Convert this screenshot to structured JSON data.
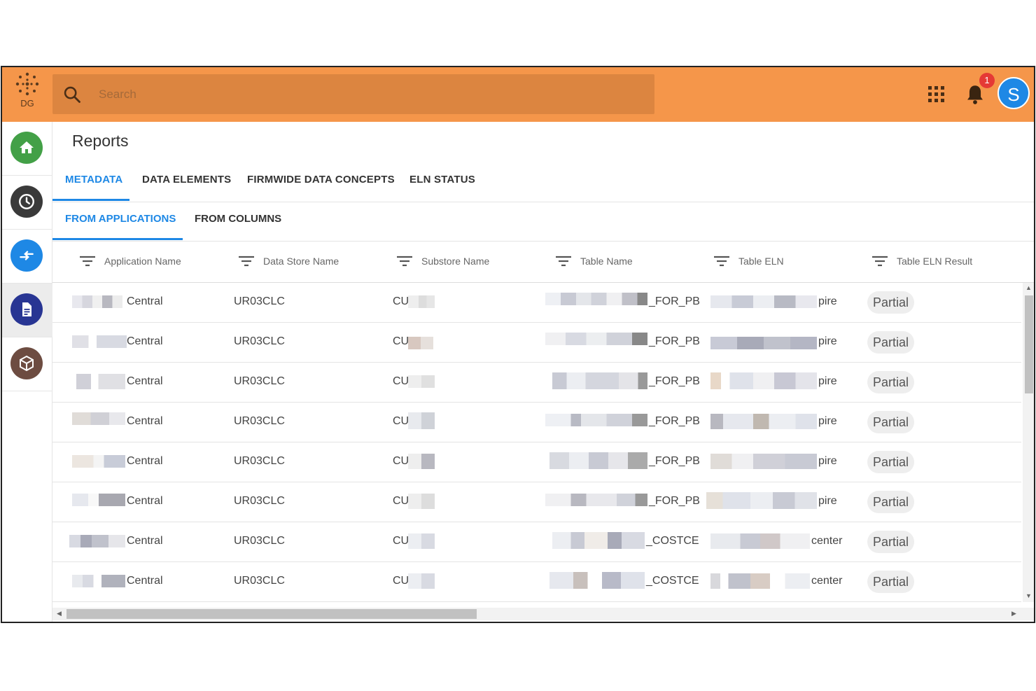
{
  "app": {
    "logo_text": "DG"
  },
  "search": {
    "placeholder": "Search"
  },
  "notifications": {
    "count": "1"
  },
  "user": {
    "initial": "S"
  },
  "page": {
    "title": "Reports"
  },
  "tabs": [
    {
      "label": "METADATA"
    },
    {
      "label": "DATA ELEMENTS"
    },
    {
      "label": "FIRMWIDE DATA CONCEPTS"
    },
    {
      "label": "ELN STATUS"
    }
  ],
  "subtabs": [
    {
      "label": "FROM APPLICATIONS"
    },
    {
      "label": "FROM COLUMNS"
    }
  ],
  "table": {
    "headers": [
      "Application Name",
      "Data Store Name",
      "Substore Name",
      "Table Name",
      "Table ELN",
      "Table ELN Result"
    ],
    "rows": [
      {
        "app": "Central",
        "store": "UR03CLC",
        "substore": "CU",
        "table": "_FOR_PB",
        "eln": "pire",
        "result": "Partial"
      },
      {
        "app": "Central",
        "store": "UR03CLC",
        "substore": "CU",
        "table": "_FOR_PB",
        "eln": "pire",
        "result": "Partial"
      },
      {
        "app": "Central",
        "store": "UR03CLC",
        "substore": "CU",
        "table": "_FOR_PB",
        "eln": "pire",
        "result": "Partial"
      },
      {
        "app": "Central",
        "store": "UR03CLC",
        "substore": "CU",
        "table": "_FOR_PB",
        "eln": "pire",
        "result": "Partial"
      },
      {
        "app": "Central",
        "store": "UR03CLC",
        "substore": "CU",
        "table": "_FOR_PB",
        "eln": "pire",
        "result": "Partial"
      },
      {
        "app": "Central",
        "store": "UR03CLC",
        "substore": "CU",
        "table": "_FOR_PB",
        "eln": "pire",
        "result": "Partial"
      },
      {
        "app": "Central",
        "store": "UR03CLC",
        "substore": "CU",
        "table": "_COSTCE",
        "eln": "center",
        "result": "Partial"
      },
      {
        "app": "Central",
        "store": "UR03CLC",
        "substore": "CU",
        "table": "_COSTCE",
        "eln": "center",
        "result": "Partial"
      }
    ]
  },
  "sidebar": {
    "items": [
      {
        "icon": "home-icon",
        "color": "#43a047"
      },
      {
        "icon": "clock-icon",
        "color": "#3a3a3a"
      },
      {
        "icon": "swap-arrows-icon",
        "color": "#1e88e5"
      },
      {
        "icon": "document-icon",
        "color": "#283593"
      },
      {
        "icon": "package-icon",
        "color": "#6d4c41"
      }
    ]
  },
  "colors": {
    "topbar": "#f5964a",
    "search": "#dc8540",
    "accent": "#1e88e5",
    "badge": "#e53935"
  }
}
